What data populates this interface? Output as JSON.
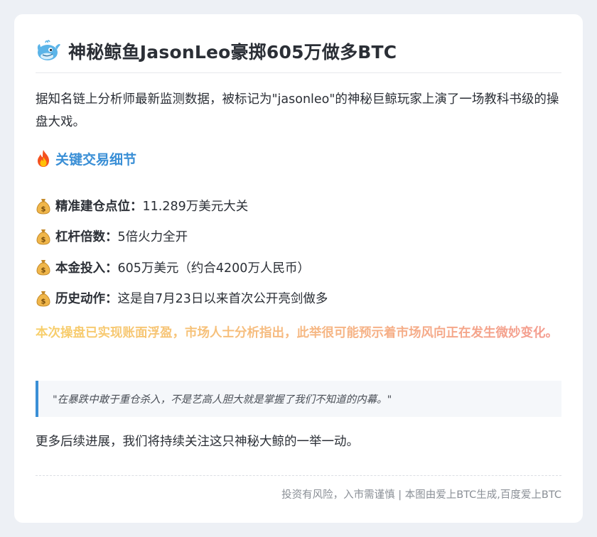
{
  "article": {
    "title_icon": "whale-icon",
    "title": "神秘鲸鱼JasonLeo豪掷605万做多BTC",
    "intro": "据知名链上分析师最新监测数据，被标记为\"jasonleo\"的神秘巨鲸玩家上演了一场教科书级的操盘大戏。",
    "section": {
      "icon": "fire-icon",
      "title": "关键交易细节"
    },
    "details": [
      {
        "icon": "moneybag-icon",
        "label": "精准建仓点位：",
        "value": "11.289万美元大关"
      },
      {
        "icon": "moneybag-icon",
        "label": "杠杆倍数：",
        "value": "5倍火力全开"
      },
      {
        "icon": "moneybag-icon",
        "label": "本金投入：",
        "value": "605万美元（约合4200万人民币）"
      },
      {
        "icon": "moneybag-icon",
        "label": "历史动作：",
        "value": "这是自7月23日以来首次公开亮剑做多"
      }
    ],
    "highlight": "本次操盘已实现账面浮盈，市场人士分析指出，此举很可能预示着市场风向正在发生微妙变化。",
    "quote": "\"在暴跌中敢于重仓杀入，不是艺高人胆大就是掌握了我们不知道的内幕。\"",
    "closing": "更多后续进展，我们将持续关注这只神秘大鲸的一举一动。",
    "footer": "投资有风险，入市需谨慎 | 本图由爱上BTC生成,百度爱上BTC"
  },
  "colors": {
    "background": "#edf0f5",
    "card": "#ffffff",
    "text": "#2b2f36",
    "accent_blue": "#3a8fd6",
    "highlight_gradient_start": "#f7cf6a",
    "highlight_gradient_end": "#f49a8f",
    "footer_text": "#8a8f96"
  }
}
